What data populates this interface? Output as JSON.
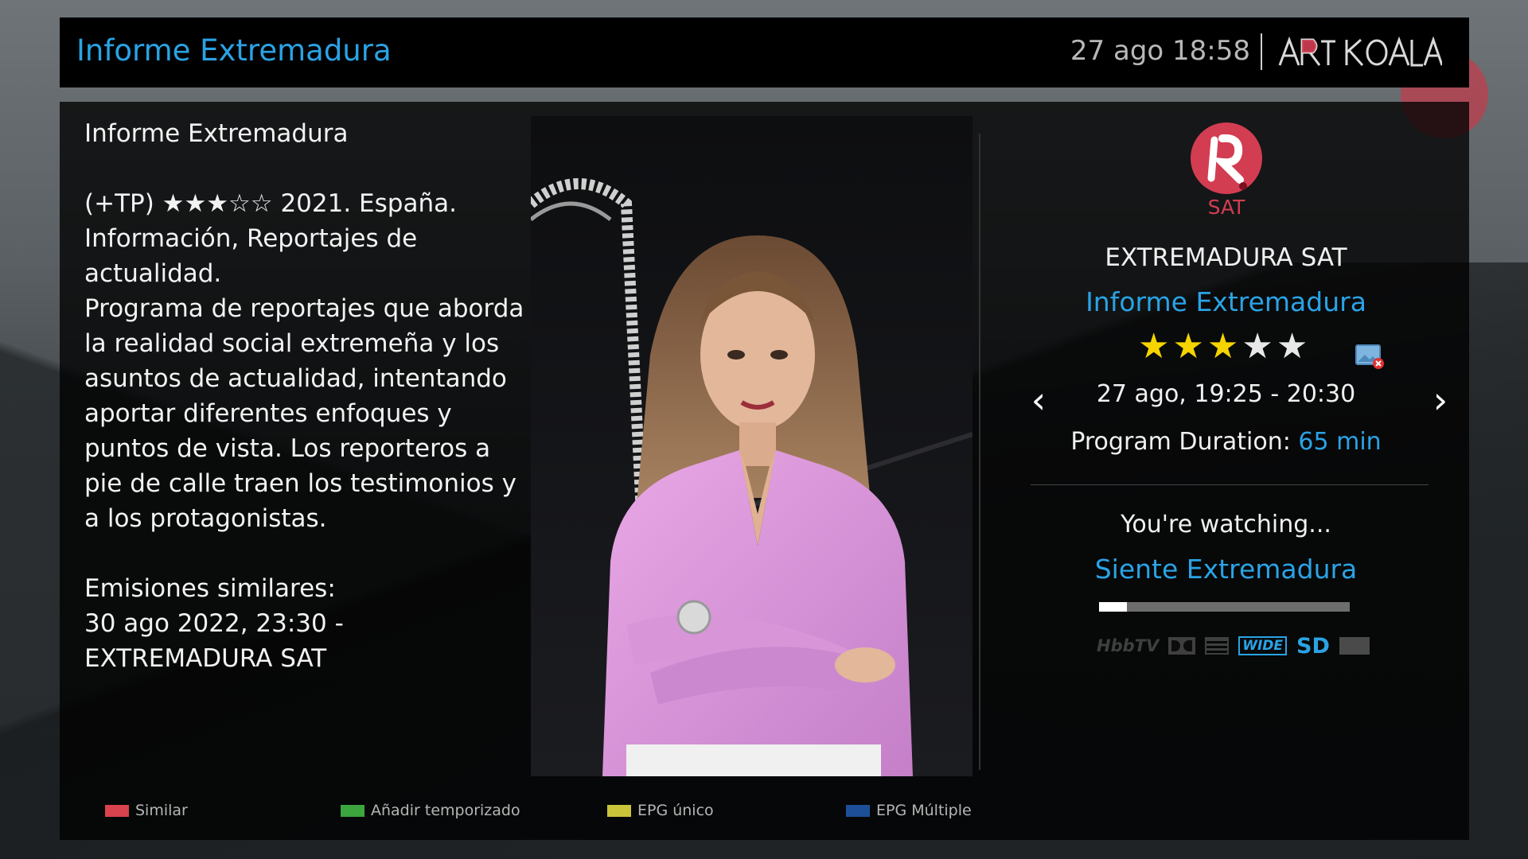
{
  "header": {
    "title": "Informe Extremadura",
    "clock": "27 ago 18:58",
    "brand_logo": "ART KOALA"
  },
  "info": {
    "title": "Informe Extremadura",
    "meta_line": "(+TP) ★★★☆☆ 2021. España.",
    "genre": "Información, Reportajes de actualidad.",
    "description": "Programa de reportajes que aborda la realidad social extremeña y los asuntos de actualidad, intentando aportar diferentes enfoques y puntos de vista. Los reporteros a pie de calle traen los testimonios y a los protagonistas.",
    "similar_label": "Emisiones similares:",
    "similar_entry": "30 ago 2022, 23:30 - EXTREMADURA SAT"
  },
  "channel": {
    "logo_label": "SAT",
    "name": "EXTREMADURA SAT",
    "program_title": "Informe Extremadura",
    "rating": 3,
    "rating_max": 5,
    "time_range": "27 ago, 19:25 - 20:30",
    "duration_label": "Program Duration:",
    "duration_value": "65 min",
    "watching_label": "You're watching...",
    "watching_title": "Siente Extremadura",
    "watching_progress": 0.11,
    "badges": [
      "HbbTV",
      "dolby-icon",
      "teletext-icon",
      "WIDE",
      "SD",
      "card-icon"
    ]
  },
  "footer": {
    "buttons": [
      {
        "label": "Similar",
        "color": "#d9434d"
      },
      {
        "label": "Añadir temporizado",
        "color": "#3da53d"
      },
      {
        "label": "EPG único",
        "color": "#c9c43a"
      },
      {
        "label": "EPG Múltiple",
        "color": "#1d4f98"
      }
    ]
  },
  "colors": {
    "accent": "#2aa3e5",
    "channel_brand": "#d33d52",
    "star": "#f5d400"
  }
}
